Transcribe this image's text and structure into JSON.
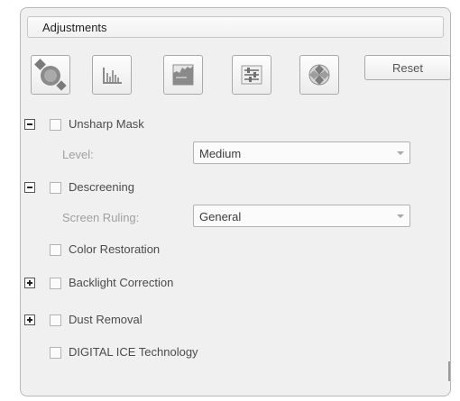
{
  "panel": {
    "title": "Adjustments"
  },
  "toolbar": {
    "buttons": [
      {
        "name": "auto-exposure-icon"
      },
      {
        "name": "histogram-icon"
      },
      {
        "name": "tone-correction-icon"
      },
      {
        "name": "image-adjustment-icon"
      },
      {
        "name": "color-palette-icon"
      }
    ],
    "reset_label": "Reset"
  },
  "options": {
    "unsharp_mask": {
      "label": "Unsharp Mask",
      "checked": false,
      "expanded": true
    },
    "level": {
      "label": "Level:",
      "value": "Medium"
    },
    "descreening": {
      "label": "Descreening",
      "checked": false,
      "expanded": true
    },
    "screen_ruling": {
      "label": "Screen Ruling:",
      "value": "General"
    },
    "color_restoration": {
      "label": "Color Restoration",
      "checked": false
    },
    "backlight_correction": {
      "label": "Backlight Correction",
      "checked": false,
      "expanded": false
    },
    "dust_removal": {
      "label": "Dust Removal",
      "checked": false,
      "expanded": false
    },
    "digital_ice": {
      "label": "DIGITAL ICE Technology",
      "checked": false
    }
  },
  "colors": {
    "panel_bg": "#f0f0f0",
    "border": "#b8b8b8",
    "disabled_text": "#a0a0a0"
  }
}
